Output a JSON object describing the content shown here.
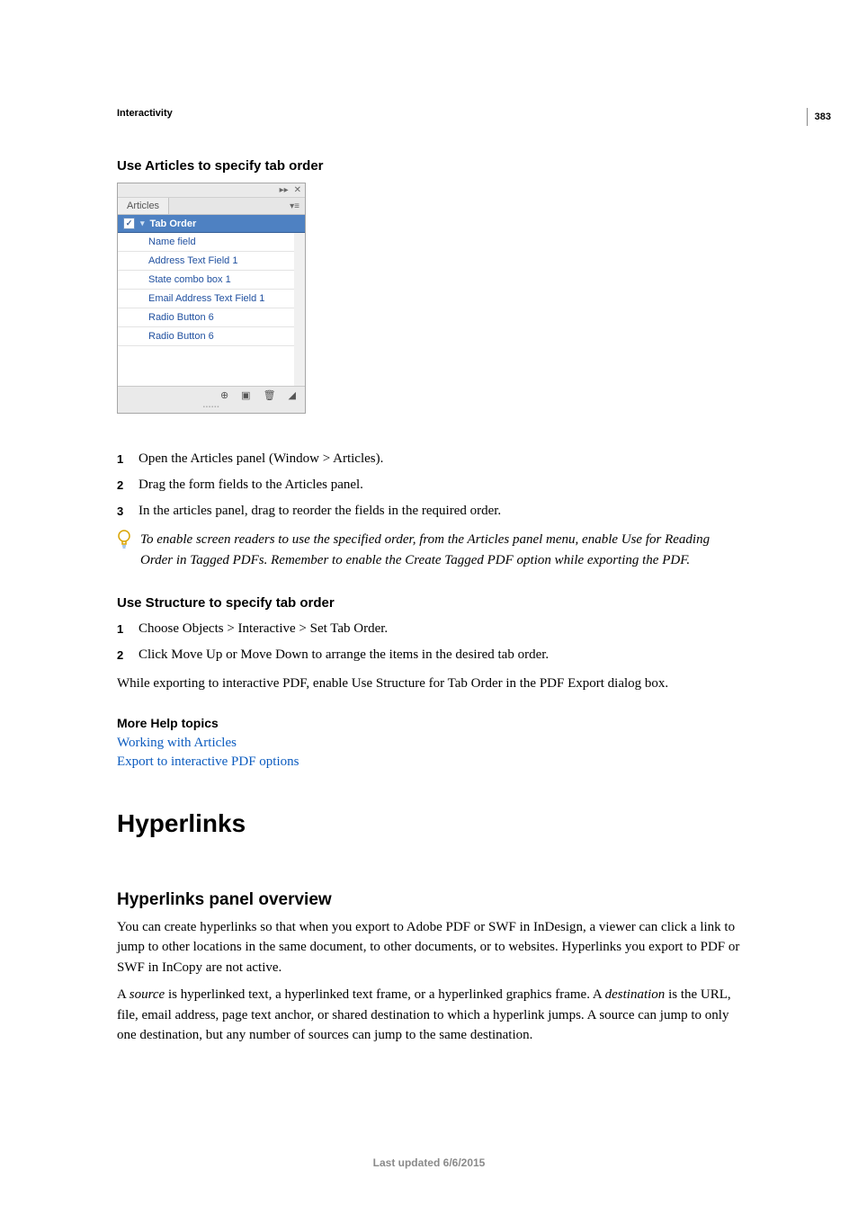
{
  "pageNumber": "383",
  "breadcrumb": "Interactivity",
  "sectionA": {
    "heading": "Use Articles to specify tab order",
    "panel": {
      "tabLabel": "Articles",
      "headerLabel": "Tab Order",
      "items": [
        "Name field",
        "Address Text Field 1",
        "State combo box 1",
        "Email Address Text Field 1",
        "Radio Button 6",
        "Radio Button 6"
      ]
    },
    "steps": [
      "Open the Articles panel (Window > Articles).",
      "Drag the form fields to the Articles panel.",
      "In the articles panel, drag to reorder the fields in the required order."
    ],
    "tip": "To enable screen readers to use the specified order, from the Articles panel menu, enable Use for Reading Order in Tagged PDFs. Remember to enable the Create Tagged PDF option while exporting the PDF."
  },
  "sectionB": {
    "heading": "Use Structure to specify tab order",
    "steps": [
      "Choose Objects > Interactive > Set Tab Order.",
      "Click Move Up or Move Down to arrange the items in the desired tab order."
    ],
    "paragraph": "While exporting to interactive PDF, enable Use Structure for Tab Order in the PDF Export dialog box."
  },
  "moreHelp": {
    "heading": "More Help topics",
    "links": [
      "Working with Articles",
      "Export to interactive PDF options"
    ]
  },
  "major": {
    "title": "Hyperlinks",
    "subheading": "Hyperlinks panel overview",
    "para1": "You can create hyperlinks so that when you export to Adobe PDF or SWF in InDesign, a viewer can click a link to jump to other locations in the same document, to other documents, or to websites. Hyperlinks you export to PDF or SWF in InCopy are not active.",
    "para2_pre": "A ",
    "para2_em1": "source",
    "para2_mid": " is hyperlinked text, a hyperlinked text frame, or a hyperlinked graphics frame. A ",
    "para2_em2": "destination",
    "para2_post": " is the URL, file, email address, page text anchor, or shared destination to which a hyperlink jumps. A source can jump to only one destination, but any number of sources can jump to the same destination."
  },
  "footer": "Last updated 6/6/2015"
}
